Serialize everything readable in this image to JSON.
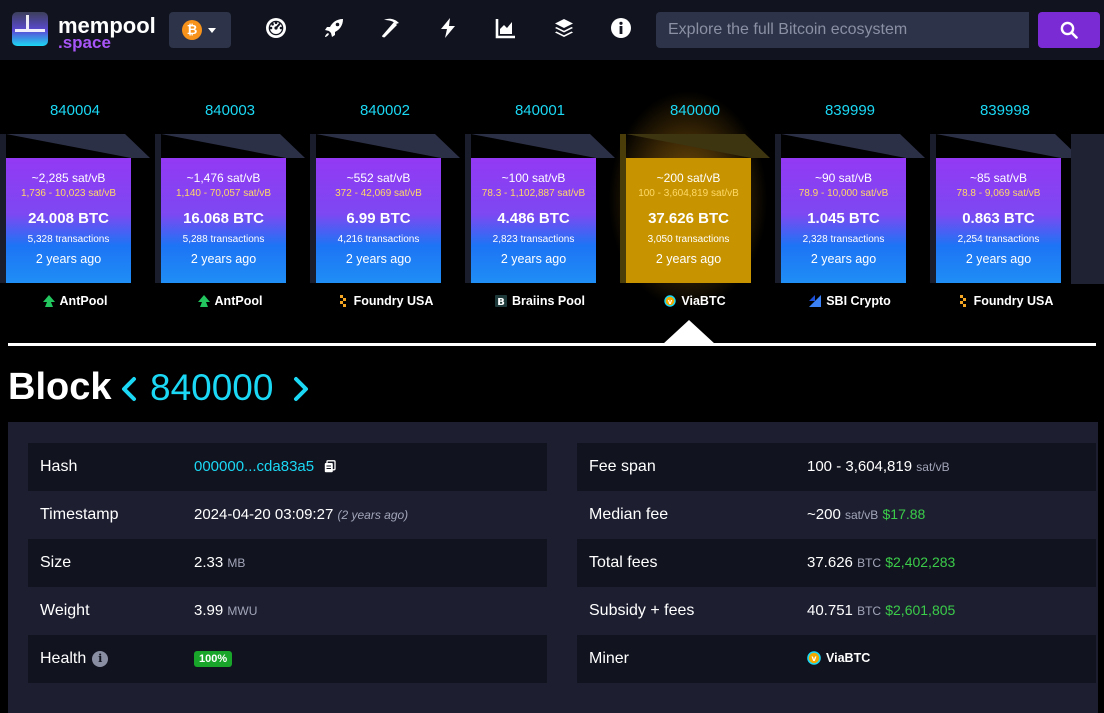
{
  "brand": {
    "line1": "mempool",
    "line2": ".space"
  },
  "network": {
    "coin_symbol": "₿",
    "coin_color": "#f7931a"
  },
  "nav_icons": [
    "dashboard-icon",
    "rocket-icon",
    "pickaxe-icon",
    "lightning-icon",
    "chart-icon",
    "layers-icon",
    "info-icon"
  ],
  "search": {
    "placeholder": "Explore the full Bitcoin ecosystem"
  },
  "colors": {
    "accent": "#1bd8f4",
    "purple": "#7b2bd4",
    "selected": "#d9a300",
    "green": "#3bcc49"
  },
  "blocks": [
    {
      "height": "840004",
      "fee": "~2,285 sat/vB",
      "range": "1,736 - 10,023 sat/vB",
      "btc": "24.008 BTC",
      "txs": "5,328 transactions",
      "ago": "2 years ago",
      "pool": "AntPool",
      "pool_icon": "antpool-icon",
      "selected": false
    },
    {
      "height": "840003",
      "fee": "~1,476 sat/vB",
      "range": "1,140 - 70,057 sat/vB",
      "btc": "16.068 BTC",
      "txs": "5,288 transactions",
      "ago": "2 years ago",
      "pool": "AntPool",
      "pool_icon": "antpool-icon",
      "selected": false
    },
    {
      "height": "840002",
      "fee": "~552 sat/vB",
      "range": "372 - 42,069 sat/vB",
      "btc": "6.99 BTC",
      "txs": "4,216 transactions",
      "ago": "2 years ago",
      "pool": "Foundry USA",
      "pool_icon": "foundry-icon",
      "selected": false
    },
    {
      "height": "840001",
      "fee": "~100 sat/vB",
      "range": "78.3 - 1,102,887 sat/vB",
      "btc": "4.486 BTC",
      "txs": "2,823 transactions",
      "ago": "2 years ago",
      "pool": "Braiins Pool",
      "pool_icon": "braiins-icon",
      "selected": false
    },
    {
      "height": "840000",
      "fee": "~200 sat/vB",
      "range": "100 - 3,604,819 sat/vB",
      "btc": "37.626 BTC",
      "txs": "3,050 transactions",
      "ago": "2 years ago",
      "pool": "ViaBTC",
      "pool_icon": "viabtc-icon",
      "selected": true
    },
    {
      "height": "839999",
      "fee": "~90 sat/vB",
      "range": "78.9 - 10,000 sat/vB",
      "btc": "1.045 BTC",
      "txs": "2,328 transactions",
      "ago": "2 years ago",
      "pool": "SBI Crypto",
      "pool_icon": "sbicrypto-icon",
      "selected": false
    },
    {
      "height": "839998",
      "fee": "~85 sat/vB",
      "range": "78.8 - 9,069 sat/vB",
      "btc": "0.863 BTC",
      "txs": "2,254 transactions",
      "ago": "2 years ago",
      "pool": "Foundry USA",
      "pool_icon": "foundry-icon",
      "selected": false
    }
  ],
  "title": {
    "word": "Block",
    "number": "840000"
  },
  "left_table": {
    "hash": {
      "label": "Hash",
      "value": "000000...cda83a5"
    },
    "timestamp": {
      "label": "Timestamp",
      "value": "2024-04-20 03:09:27",
      "relative": "(2 years ago)"
    },
    "size": {
      "label": "Size",
      "value": "2.33",
      "unit": "MB"
    },
    "weight": {
      "label": "Weight",
      "value": "3.99",
      "unit": "MWU"
    },
    "health": {
      "label": "Health",
      "value": "100%"
    }
  },
  "right_table": {
    "fee_span": {
      "label": "Fee span",
      "value": "100 - 3,604,819",
      "unit": "sat/vB"
    },
    "median_fee": {
      "label": "Median fee",
      "value": "~200",
      "unit": "sat/vB",
      "usd": "$17.88"
    },
    "total_fees": {
      "label": "Total fees",
      "value": "37.626",
      "unit": "BTC",
      "usd": "$2,402,283"
    },
    "subsidy": {
      "label": "Subsidy + fees",
      "value": "40.751",
      "unit": "BTC",
      "usd": "$2,601,805"
    },
    "miner": {
      "label": "Miner",
      "value": "ViaBTC"
    }
  }
}
